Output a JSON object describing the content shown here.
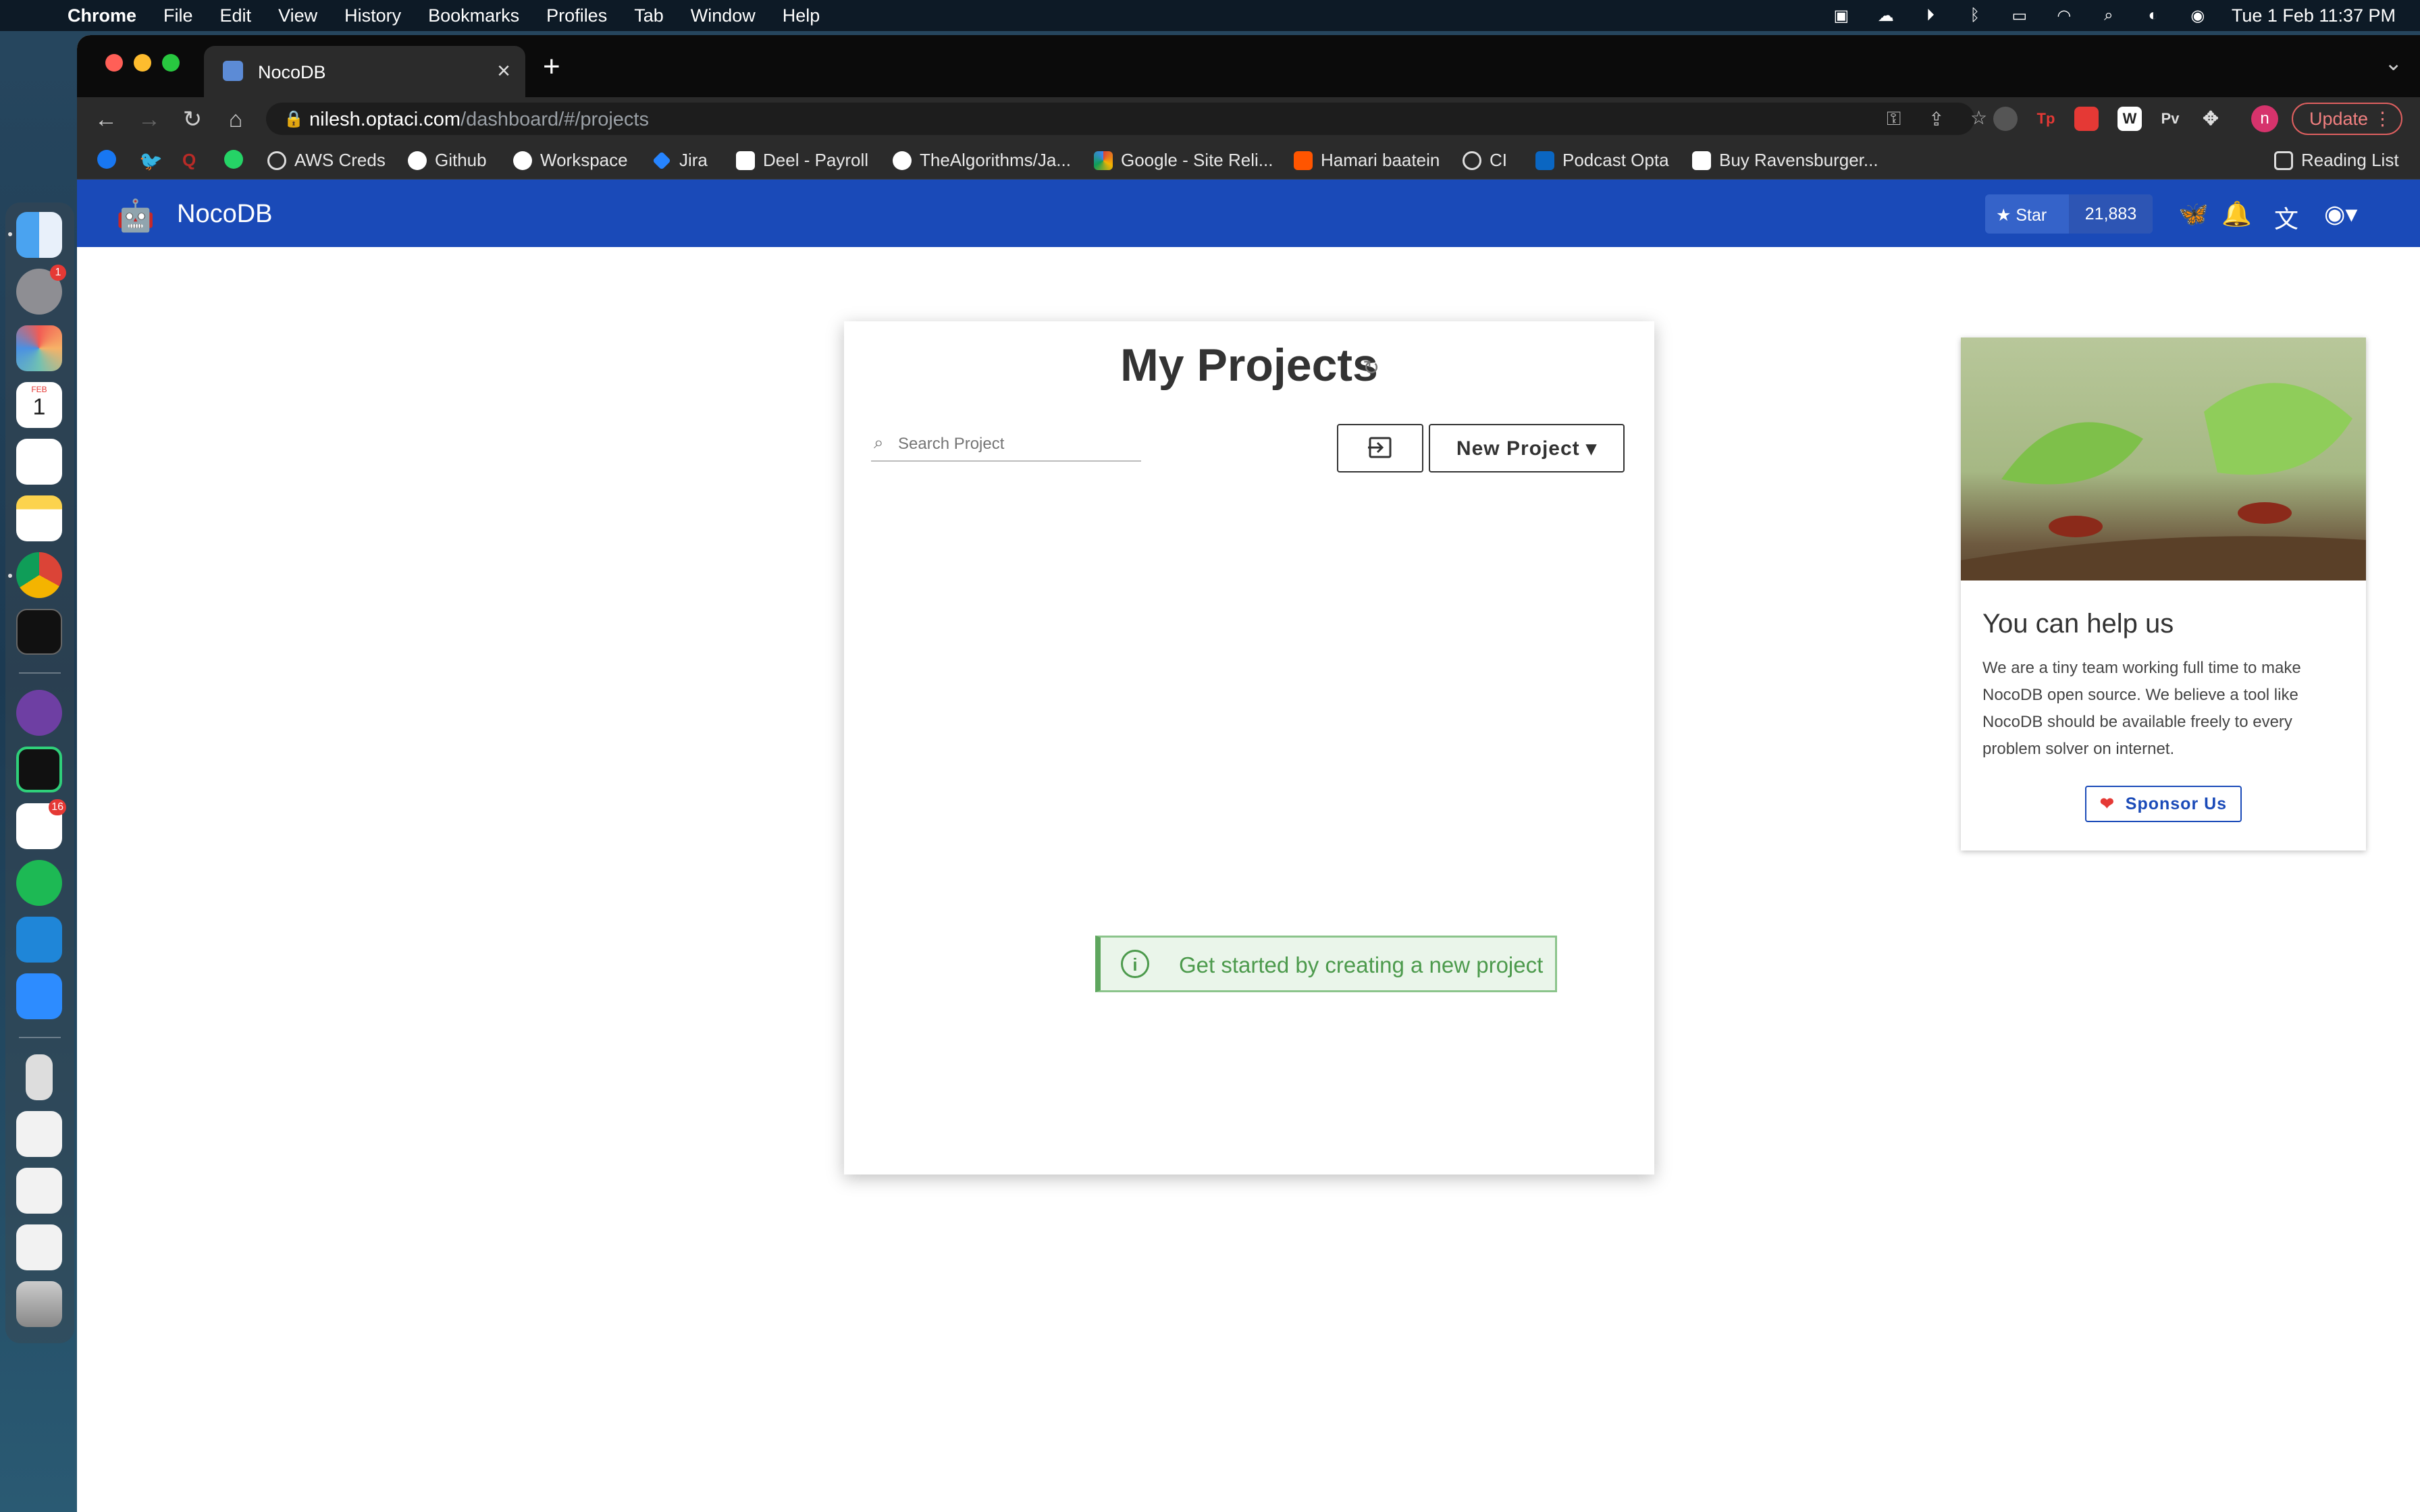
{
  "menubar": {
    "app_name": "Chrome",
    "items": [
      "File",
      "Edit",
      "View",
      "History",
      "Bookmarks",
      "Profiles",
      "Tab",
      "Window",
      "Help"
    ],
    "clock": "Tue 1 Feb  11:37 PM"
  },
  "dock": {
    "calendar_month": "FEB",
    "calendar_day": "1",
    "settings_badge": "1",
    "slack_badge": "16"
  },
  "browser": {
    "tab_title": "NocoDB",
    "url_host": "nilesh.optaci.com",
    "url_path": "/dashboard/#/projects",
    "update_label": "Update",
    "profile_initial": "n",
    "extensions": [
      "Tp",
      "W",
      "Pv"
    ],
    "bookmarks": [
      "AWS Creds",
      "Github",
      "Workspace",
      "Jira",
      "Deel - Payroll",
      "TheAlgorithms/Ja...",
      "Google - Site Reli...",
      "Hamari baatein",
      "CI",
      "Podcast Opta",
      "Buy Ravensburger..."
    ],
    "reading_list": "Reading List"
  },
  "app": {
    "brand": "NocoDB",
    "star_label": "Star",
    "star_count": "21,883"
  },
  "projects": {
    "heading": "My Projects",
    "search_placeholder": "Search Project",
    "new_project_label": "New Project",
    "empty_message": "Get started by creating a new project"
  },
  "sponsor": {
    "title": "You can help us",
    "body": "We are a tiny team working full time to make NocoDB open source. We believe a tool like NocoDB should be available freely to every problem solver on internet.",
    "button_label": "Sponsor Us"
  },
  "colors": {
    "app_bar": "#1a4ab8",
    "alert_green": "#4c9a4c",
    "sponsor_heart": "#e53935"
  }
}
